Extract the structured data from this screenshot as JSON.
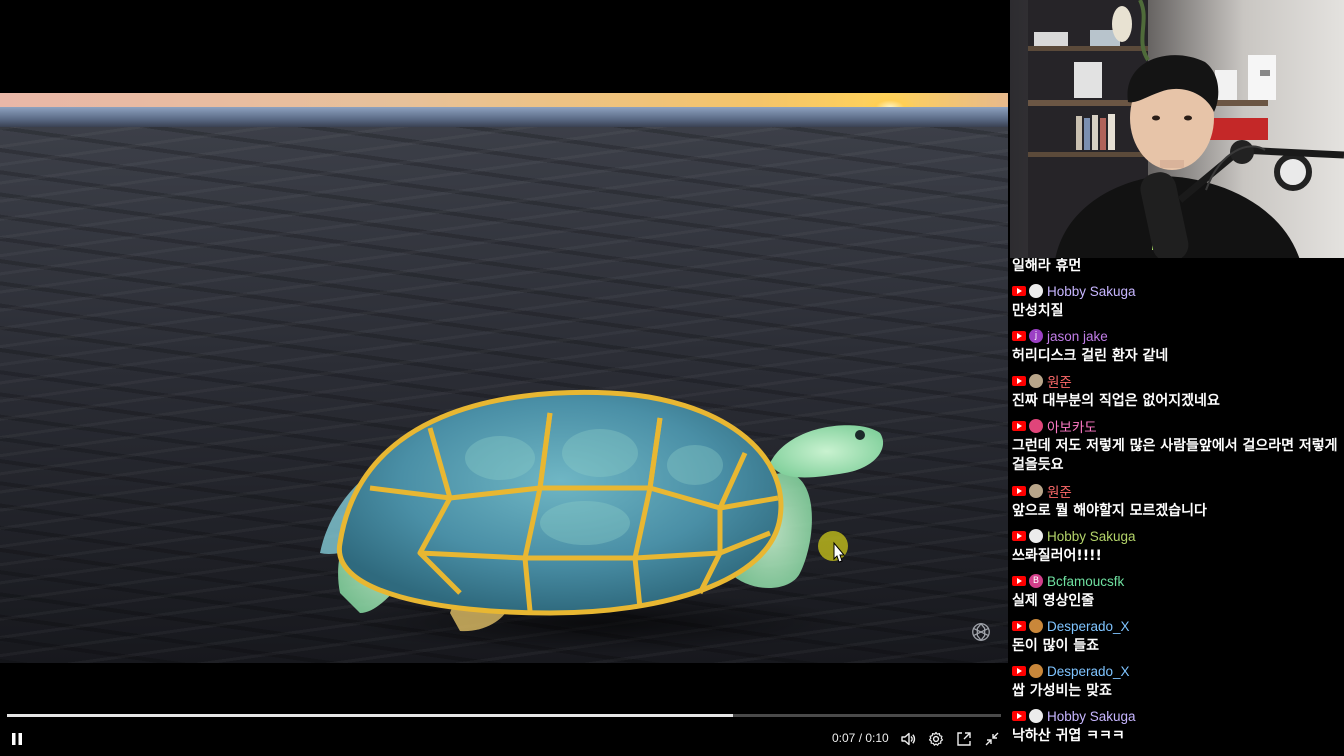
{
  "player": {
    "time_current": "0:07",
    "time_total": "0:10",
    "time_separator": " / ",
    "progress_fraction": 0.73,
    "icons": {
      "pause": "pause-icon",
      "volume": "volume-icon",
      "settings": "gear-icon",
      "pip": "picture-in-picture-icon",
      "exit_fullscreen": "exit-fullscreen-icon",
      "watermark": "openai-logo-icon"
    }
  },
  "chat": {
    "top_partial_text": "일해라 휴먼",
    "messages": [
      {
        "author": "Hobby Sakuga",
        "color": "#c7b6ff",
        "avatar_color": "#ececec",
        "avatar_letter": "",
        "text": "만성치질"
      },
      {
        "author": "jason jake",
        "color": "#c27ee8",
        "avatar_color": "#9b3fc4",
        "avatar_letter": "j",
        "text": "허리디스크 걸린 환자 같네"
      },
      {
        "author": "원준",
        "color": "#ff6a6a",
        "avatar_color": "#b9a68a",
        "avatar_letter": "",
        "text": "진짜 대부분의 직업은 없어지겠네요"
      },
      {
        "author": "아보카도",
        "color": "#ff7ac7",
        "avatar_color": "#e0457a",
        "avatar_letter": "",
        "text": "그런데 저도 저렇게 많은 사람들앞에서 걸으라면 저렇게 걸을듯요"
      },
      {
        "author": "원준",
        "color": "#ff6a6a",
        "avatar_color": "#b9a68a",
        "avatar_letter": "",
        "text": "앞으로 뭘 해야할지 모르겠습니다"
      },
      {
        "author": "Hobby Sakuga",
        "color": "#b4d46a",
        "avatar_color": "#ececec",
        "avatar_letter": "",
        "text": "쓰롸질러어!!!!"
      },
      {
        "author": "Bcfamoucsfk",
        "color": "#6fe0a0",
        "avatar_color": "#d23f8a",
        "avatar_letter": "B",
        "text": "실제 영상인줄"
      },
      {
        "author": "Desperado_X",
        "color": "#7fc4ff",
        "avatar_color": "#c9873a",
        "avatar_letter": "",
        "text": "돈이 많이 들죠"
      },
      {
        "author": "Desperado_X",
        "color": "#7fc4ff",
        "avatar_color": "#c9873a",
        "avatar_letter": "",
        "text": "쌉 가성비는 맞죠"
      },
      {
        "author": "Hobby Sakuga",
        "color": "#c7b6ff",
        "avatar_color": "#ececec",
        "avatar_letter": "",
        "text": "낙하산 귀엽 ㅋㅋㅋ"
      }
    ]
  }
}
